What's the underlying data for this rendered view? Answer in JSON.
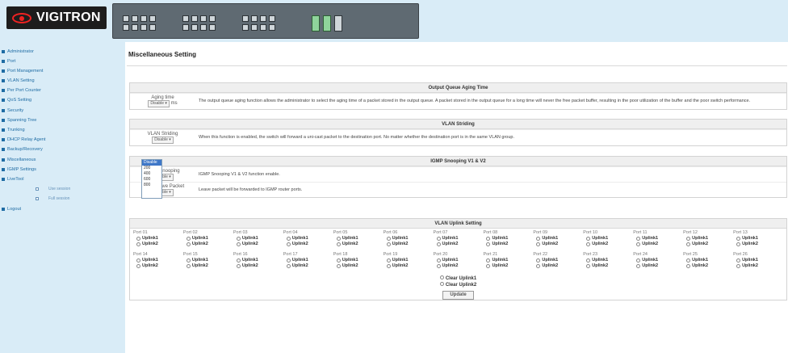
{
  "brand": {
    "name": "VIGITRON",
    "logo_icon": "eye-logo-icon"
  },
  "sidebar": {
    "items": [
      {
        "label": "Administrator"
      },
      {
        "label": "Port"
      },
      {
        "label": "Port Management"
      },
      {
        "label": "VLAN Setting"
      },
      {
        "label": "Per Port Counter"
      },
      {
        "label": "QoS Setting"
      },
      {
        "label": "Security"
      },
      {
        "label": "Spanning Tree"
      },
      {
        "label": "Trunking"
      },
      {
        "label": "DHCP Relay Agent"
      },
      {
        "label": "Backup/Recovery"
      },
      {
        "label": "Miscellaneous"
      },
      {
        "label": "IGMP Settings"
      },
      {
        "label": "LiveTool"
      }
    ],
    "subitems": [
      {
        "label": "Use session"
      },
      {
        "label": "Full session"
      }
    ],
    "logout": "Logout"
  },
  "page": {
    "title": "Miscellaneous Setting"
  },
  "output_queue": {
    "header": "Output Queue Aging Time",
    "label": "Aging time",
    "select_value": "Disable",
    "unit": "ms",
    "desc": "The output queue aging function allows the administrator to select the aging time of a packet stored in the output queue. A packet stored in the output queue for a long time will never the free packet buffer, resulting in the poor utilization of the buffer and the poor switch performance.",
    "options": [
      "Disable",
      "200",
      "400",
      "600",
      "800"
    ]
  },
  "vlan_striding": {
    "header": "VLAN Striding",
    "label": "VLAN Striding",
    "select_value": "Disable",
    "desc": "When this function is enabled, the switch will forward a uni-cast packet to the destination port. No matter whether the destination port is in the same VLAN group."
  },
  "igmp": {
    "header": "IGMP Snooping V1 & V2",
    "snoop_label": "IGMP Snooping",
    "snoop_value": "Disable",
    "snoop_desc": "IGMP Snooping V1 & V2 function enable.",
    "leave_label": "IGMP Leave Packet",
    "leave_value": "Disable",
    "leave_desc": "Leave packet will be forwarded to IGMP router ports."
  },
  "uplink": {
    "header": "VLAN Uplink Setting",
    "opt1": "Uplink1",
    "opt2": "Uplink2",
    "ports": [
      "Port 01",
      "Port 02",
      "Port 03",
      "Port 04",
      "Port 05",
      "Port 06",
      "Port 07",
      "Port 08",
      "Port 09",
      "Port 10",
      "Port 11",
      "Port 12",
      "Port 13",
      "Port 14",
      "Port 15",
      "Port 16",
      "Port 17",
      "Port 18",
      "Port 19",
      "Port 20",
      "Port 21",
      "Port 22",
      "Port 23",
      "Port 24",
      "Port 25",
      "Port 26"
    ],
    "clear1": "Clear Uplink1",
    "clear2": "Clear Uplink2",
    "update": "Update"
  }
}
